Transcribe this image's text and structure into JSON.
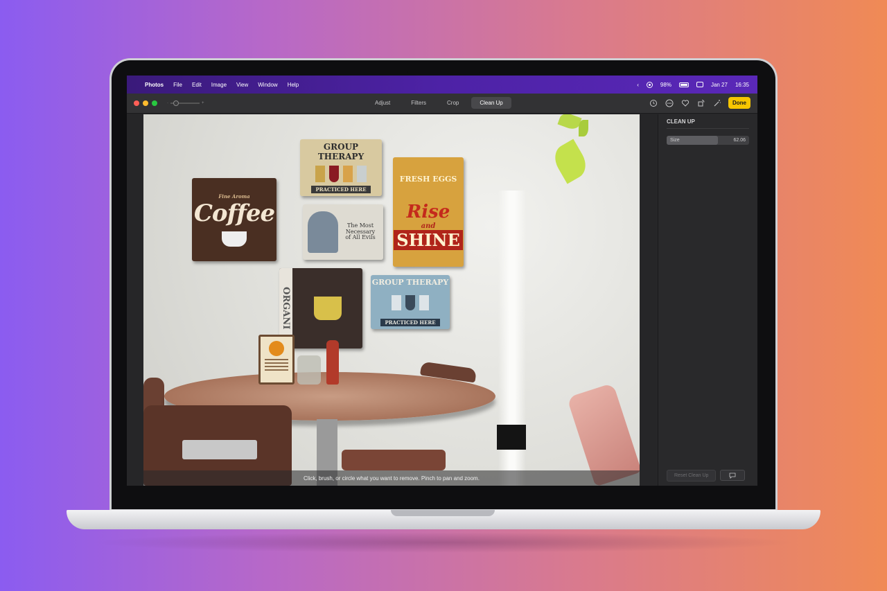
{
  "menubar": {
    "apple": "",
    "app_name": "Photos",
    "menus": [
      "File",
      "Edit",
      "Image",
      "View",
      "Window",
      "Help"
    ],
    "battery": "98%",
    "date": "Jan 27",
    "time": "16:35"
  },
  "toolbar": {
    "tabs": [
      "Adjust",
      "Filters",
      "Crop",
      "Clean Up"
    ],
    "active_tab": "Clean Up",
    "done_label": "Done",
    "traffic_lights": {
      "close": "#ff5f57",
      "minimize": "#febc2e",
      "zoom": "#28c840"
    }
  },
  "photo": {
    "signs": {
      "coffee": {
        "title": "Coffee",
        "sub": "Fine Aroma"
      },
      "group_therapy_top": {
        "title": "GROUP THERAPY",
        "sub": "PRACTICED HERE"
      },
      "fresh_eggs": {
        "line1": "FRESH EGGS",
        "line2": "Rise",
        "line3": "and",
        "line4": "SHINE"
      },
      "woman": {
        "text": "The Most Necessary of All Evils"
      },
      "organic": {
        "text": "ORGANI"
      },
      "group_therapy_bottom": {
        "title": "GROUP THERAPY",
        "sub": "PRACTICED HERE"
      }
    },
    "hint": "Click, brush, or circle what you want to remove. Pinch to pan and zoom."
  },
  "sidebar": {
    "title": "CLEAN UP",
    "size_label": "Size",
    "size_value": "62.06",
    "size_fraction": 0.62,
    "reset_label": "Reset Clean Up"
  },
  "colors": {
    "accent": "#f7c600",
    "menubar": "#4d22a6"
  }
}
